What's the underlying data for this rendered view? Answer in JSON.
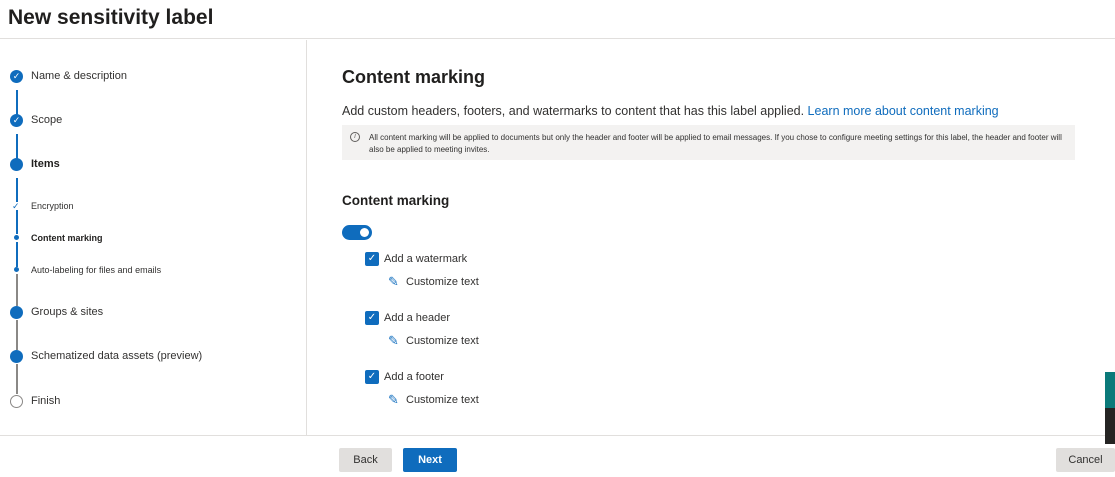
{
  "header": {
    "title": "New sensitivity label"
  },
  "colors": {
    "accent": "#0f6cbd",
    "border": "#e1dfdd",
    "infobox_bg": "#f3f2f1",
    "button_secondary": "#e1dfdd"
  },
  "sidebar": {
    "steps": [
      {
        "label": "Name & description",
        "state": "completed",
        "icon": "checkmark-circle-icon"
      },
      {
        "label": "Scope",
        "state": "completed",
        "icon": "checkmark-circle-icon"
      },
      {
        "label": "Items",
        "state": "current",
        "icon": "filled-circle-icon"
      },
      {
        "label": "Encryption",
        "state": "completed-substep",
        "icon": "small-check-icon"
      },
      {
        "label": "Content marking",
        "state": "current-substep",
        "icon": "small-dot-icon"
      },
      {
        "label": "Auto-labeling for files and emails",
        "state": "substep",
        "icon": "small-dot-icon"
      },
      {
        "label": "Groups & sites",
        "state": "upcoming",
        "icon": "filled-circle-icon"
      },
      {
        "label": "Schematized data assets (preview)",
        "state": "upcoming",
        "icon": "filled-circle-icon"
      },
      {
        "label": "Finish",
        "state": "not-started",
        "icon": "empty-circle-icon"
      }
    ]
  },
  "main": {
    "title": "Content marking",
    "description": "Add custom headers, footers, and watermarks to content that has this label applied. ",
    "learn_more": "Learn more about content marking",
    "info": "All content marking will be applied to documents but only the header and footer will be applied to email messages. If you chose to configure meeting settings for this label, the header and footer will also be applied to meeting invites.",
    "section_title": "Content marking",
    "toggle_on": true,
    "options": [
      {
        "label": "Add a watermark",
        "checked": true,
        "customize": "Customize text"
      },
      {
        "label": "Add a header",
        "checked": true,
        "customize": "Customize text"
      },
      {
        "label": "Add a footer",
        "checked": true,
        "customize": "Customize text"
      }
    ]
  },
  "footer": {
    "back": "Back",
    "next": "Next",
    "cancel": "Cancel"
  }
}
